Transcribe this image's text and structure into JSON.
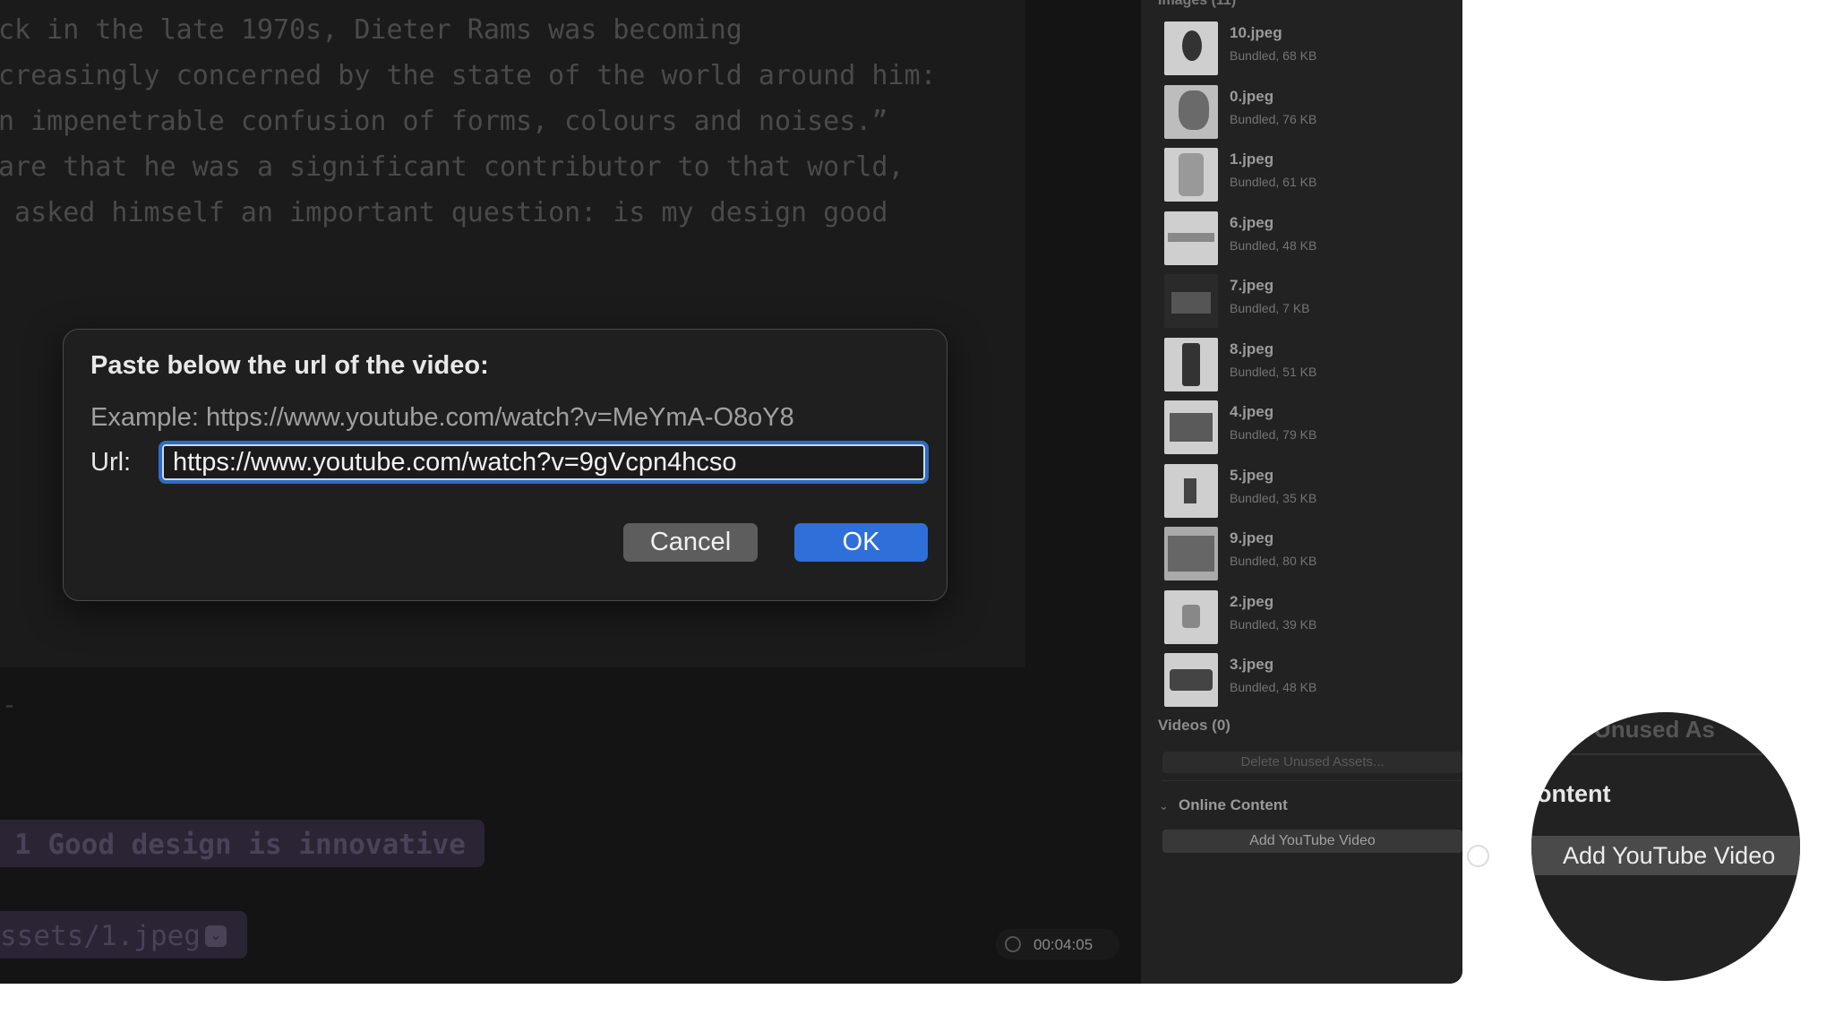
{
  "editor": {
    "prose_lines": [
      "ck in the late 1970s, Dieter Rams was becoming",
      "creasingly concerned by the state of the world around him:",
      "n impenetrable confusion of forms, colours and noises.”",
      "are that he was a significant contributor to that world,",
      " asked himself an important question: is my design good"
    ],
    "dash": "-",
    "heading": "1 Good design is innovative",
    "asset_path": "ssets/1.jpeg",
    "timer": "00:04:05"
  },
  "dialog": {
    "title": "Paste below the url of the video:",
    "example": "Example: https://www.youtube.com/watch?v=MeYmA-O8oY8",
    "url_label": "Url:",
    "url_value": "https://www.youtube.com/watch?v=9gVcpn4hcso",
    "cancel_label": "Cancel",
    "ok_label": "OK",
    "accent_color": "#2f6fd9"
  },
  "sidebar": {
    "images_header": "Images (11)",
    "images": [
      {
        "name": "10.jpeg",
        "meta": "Bundled, 68 KB"
      },
      {
        "name": "0.jpeg",
        "meta": "Bundled, 76 KB"
      },
      {
        "name": "1.jpeg",
        "meta": "Bundled, 61 KB"
      },
      {
        "name": "6.jpeg",
        "meta": "Bundled, 48 KB"
      },
      {
        "name": "7.jpeg",
        "meta": "Bundled, 7 KB"
      },
      {
        "name": "8.jpeg",
        "meta": "Bundled, 51 KB"
      },
      {
        "name": "4.jpeg",
        "meta": "Bundled, 79 KB"
      },
      {
        "name": "5.jpeg",
        "meta": "Bundled, 35 KB"
      },
      {
        "name": "9.jpeg",
        "meta": "Bundled, 80 KB"
      },
      {
        "name": "2.jpeg",
        "meta": "Bundled, 39 KB"
      },
      {
        "name": "3.jpeg",
        "meta": "Bundled, 48 KB"
      }
    ],
    "videos_header": "Videos (0)",
    "delete_unused_label": "Delete Unused Assets...",
    "online_content_header": "Online Content",
    "add_youtube_label": "Add YouTube Video"
  },
  "magnifier": {
    "unused_fragment": "Unused As",
    "content_fragment": "ontent",
    "button_label": "Add YouTube Video"
  }
}
